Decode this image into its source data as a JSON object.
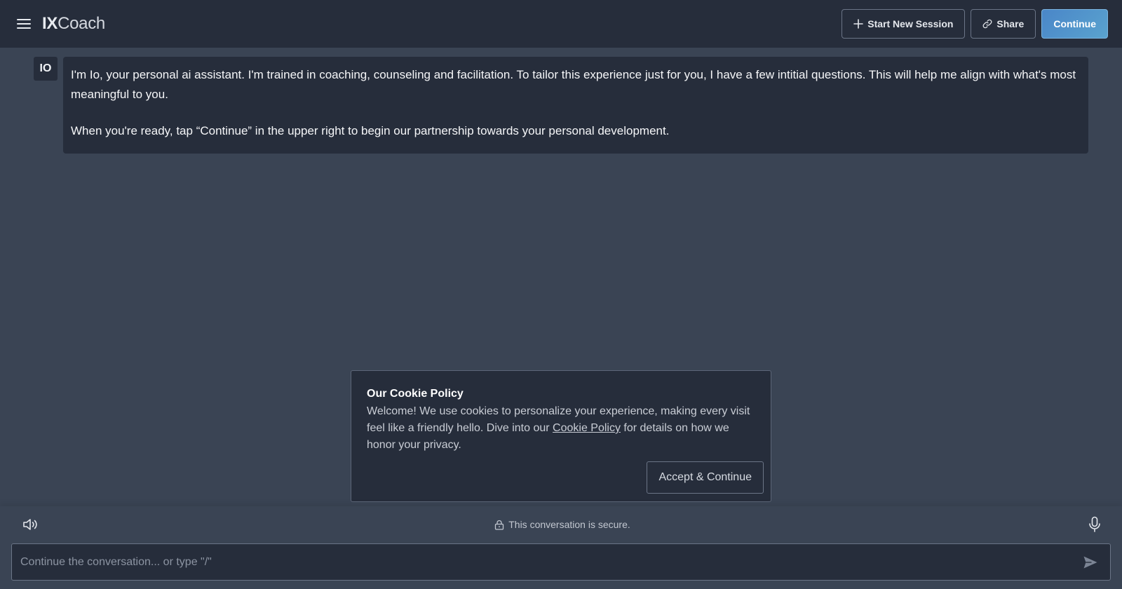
{
  "header": {
    "logo_bold": "IX",
    "logo_light": "Coach",
    "start_new_session_label": "Start New Session",
    "share_label": "Share",
    "continue_label": "Continue"
  },
  "message": {
    "avatar_label": "IO",
    "paragraph_1": "I'm Io, your personal ai assistant. I'm trained in coaching, counseling and facilitation. To tailor this experience just for you, I have a few intitial questions. This will help me align with what's most meaningful to you.",
    "paragraph_2": "When you're ready, tap “Continue” in the upper right to begin our partnership towards your personal development."
  },
  "cookie": {
    "title": "Our Cookie Policy",
    "text_before_link": "Welcome! We use cookies to personalize your experience, making every visit feel like a friendly hello. Dive into our ",
    "link_label": "Cookie Policy",
    "text_after_link": " for details on how we honor your privacy.",
    "accept_label": "Accept & Continue"
  },
  "footer": {
    "secure_text": "This conversation is secure.",
    "input_placeholder": "Continue the conversation... or type \"/\"",
    "input_value": ""
  },
  "colors": {
    "background": "#3a4454",
    "panel": "#262d3b",
    "accent": "#4a86c8"
  }
}
